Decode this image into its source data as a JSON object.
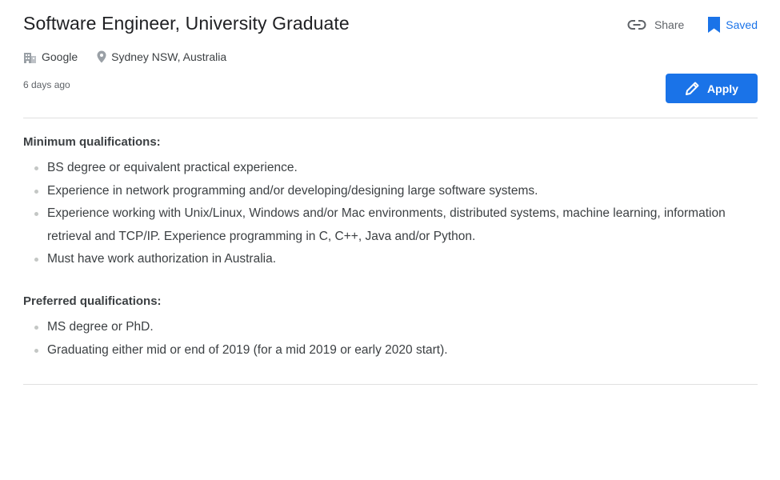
{
  "job": {
    "title": "Software Engineer, University Graduate",
    "company": "Google",
    "location": "Sydney NSW, Australia",
    "posted": "6 days ago"
  },
  "actions": {
    "share_label": "Share",
    "saved_label": "Saved",
    "apply_label": "Apply"
  },
  "minimum_qualifications": {
    "heading": "Minimum qualifications:",
    "items": [
      "BS degree or equivalent practical experience.",
      "Experience in network programming and/or developing/designing large software systems.",
      "Experience working with Unix/Linux, Windows and/or Mac environments, distributed systems, machine learning, information retrieval and TCP/IP. Experience programming in C, C++, Java and/or Python.",
      "Must have work authorization in Australia."
    ]
  },
  "preferred_qualifications": {
    "heading": "Preferred qualifications:",
    "items": [
      "MS degree or PhD.",
      "Graduating either mid or end of 2019 (for a mid 2019 or early 2020 start)."
    ]
  },
  "icons": {
    "share": "link-icon",
    "saved": "bookmark-icon",
    "company": "building-icon",
    "location": "location-pin-icon",
    "apply": "pencil-icon"
  },
  "colors": {
    "accent": "#1a73e8",
    "text": "#202124",
    "muted": "#5f6368"
  }
}
